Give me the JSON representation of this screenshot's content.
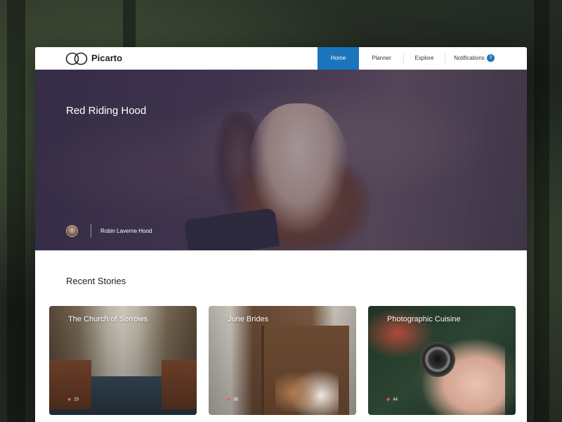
{
  "brand": {
    "name": "Picarto",
    "logo_icon": "infinity-logo-icon"
  },
  "nav": {
    "items": [
      {
        "label": "Home",
        "active": true
      },
      {
        "label": "Planner",
        "active": false
      },
      {
        "label": "Explore",
        "active": false
      },
      {
        "label": "Notifications",
        "active": false,
        "badge": "3"
      }
    ]
  },
  "hero": {
    "title": "Red Riding Hood",
    "author": {
      "name": "Robin Laverne Hood",
      "avatar_icon": "avatar-icon"
    }
  },
  "recent": {
    "title": "Recent Stories",
    "cards": [
      {
        "title": "The Church of Sorrows",
        "likes": "23",
        "like_icon": "heart-icon"
      },
      {
        "title": "June Brides",
        "likes": "38",
        "like_icon": "heart-icon"
      },
      {
        "title": "Photographic Cuisine",
        "likes": "44",
        "like_icon": "heart-icon"
      }
    ]
  },
  "colors": {
    "accent": "#1b75bc",
    "heart": "#e8586b"
  }
}
